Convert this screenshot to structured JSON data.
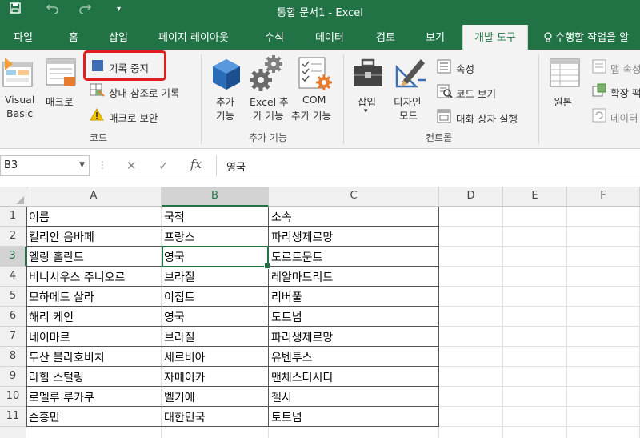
{
  "window": {
    "title": "통합 문서1 - Excel"
  },
  "tabs": [
    "파일",
    "홈",
    "삽입",
    "페이지 레이아웃",
    "수식",
    "데이터",
    "검토",
    "보기",
    "개발 도구"
  ],
  "active_tab": "개발 도구",
  "tell_me": "수행할 작업을 알",
  "ribbon": {
    "code": {
      "visual_basic_line1": "Visual",
      "visual_basic_line2": "Basic",
      "macros": "매크로",
      "stop_recording": "기록 중지",
      "relative_ref": "상대 참조로 기록",
      "macro_security": "매크로 보안",
      "group_label": "코드"
    },
    "addins": {
      "addins_line1": "추가",
      "addins_line2": "기능",
      "excel_addins_line1": "Excel 추",
      "excel_addins_line2": "가 기능",
      "com_addins_line1": "COM",
      "com_addins_line2": "추가 기능",
      "group_label": "추가 기능"
    },
    "controls": {
      "insert": "삽입",
      "design_mode_line1": "디자인",
      "design_mode_line2": "모드",
      "properties": "속성",
      "view_code": "코드 보기",
      "run_dialog": "대화 상자 실행",
      "group_label": "컨트롤"
    },
    "xml": {
      "source": "원본",
      "map_properties": "맵 속성",
      "expansion_packs": "확장 팩",
      "refresh_data": "데이터"
    }
  },
  "formula_bar": {
    "name_box": "B3",
    "value": "영국"
  },
  "columns": [
    "A",
    "B",
    "C",
    "D",
    "E",
    "F"
  ],
  "selected_column": "B",
  "selected_row": 3,
  "rows": [
    {
      "num": "1",
      "cells": [
        "이름",
        "국적",
        "소속"
      ]
    },
    {
      "num": "2",
      "cells": [
        "킬리안 음바페",
        "프랑스",
        "파리생제르망"
      ]
    },
    {
      "num": "3",
      "cells": [
        "엘링 홀란드",
        "영국",
        "도르트문트"
      ]
    },
    {
      "num": "4",
      "cells": [
        "비니시우스 주니오르",
        "브라질",
        "레알마드리드"
      ]
    },
    {
      "num": "5",
      "cells": [
        "모하메드 살라",
        "이집트",
        "리버풀"
      ]
    },
    {
      "num": "6",
      "cells": [
        "해리 케인",
        "영국",
        "도트넘"
      ]
    },
    {
      "num": "7",
      "cells": [
        "네이마르",
        "브라질",
        "파리생제르망"
      ]
    },
    {
      "num": "8",
      "cells": [
        "두산 블라호비치",
        "세르비아",
        "유벤투스"
      ]
    },
    {
      "num": "9",
      "cells": [
        "라힘 스털링",
        "자메이카",
        "맨체스터시티"
      ]
    },
    {
      "num": "10",
      "cells": [
        "로멜루 루카쿠",
        "벨기에",
        "첼시"
      ]
    },
    {
      "num": "11",
      "cells": [
        "손흥민",
        "대한민국",
        "토트넘"
      ]
    }
  ],
  "colors": {
    "excel_green": "#217346",
    "highlight_red": "#e01e1e"
  }
}
